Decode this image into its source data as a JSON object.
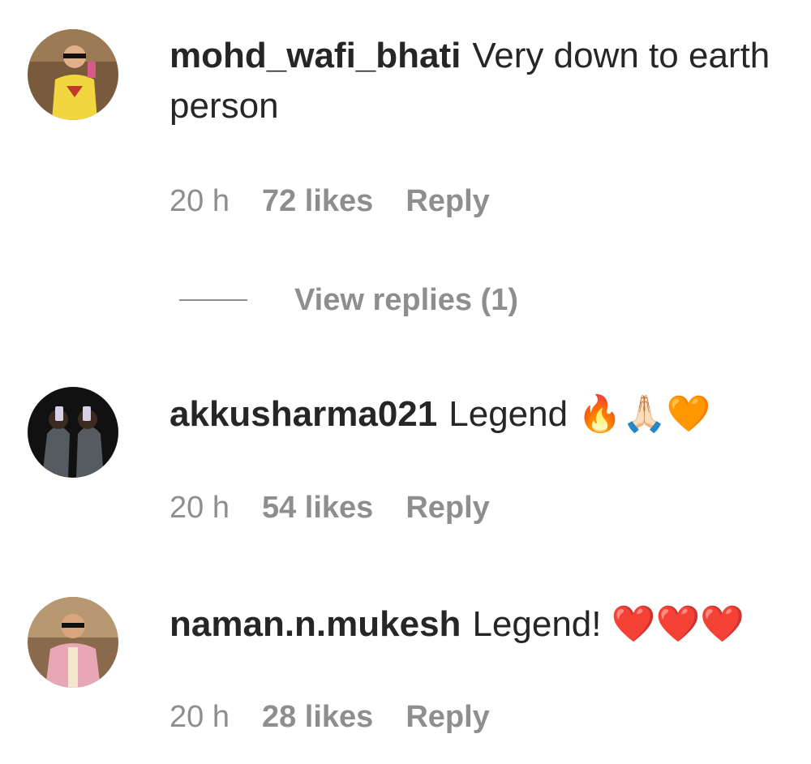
{
  "comments": [
    {
      "username": "mohd_wafi_bhati",
      "text": "Very down to earth person",
      "time": "20 h",
      "likes": "72 likes",
      "reply_label": "Reply",
      "view_replies": "View replies (1)"
    },
    {
      "username": "akkusharma021",
      "text": "Legend 🔥🙏🏻🧡",
      "time": "20 h",
      "likes": "54 likes",
      "reply_label": "Reply"
    },
    {
      "username": "naman.n.mukesh",
      "text": "Legend! ❤️❤️❤️",
      "time": "20 h",
      "likes": "28 likes",
      "reply_label": "Reply"
    }
  ],
  "colors": {
    "text": "#262626",
    "meta": "#8e8e8e",
    "background": "#ffffff"
  }
}
